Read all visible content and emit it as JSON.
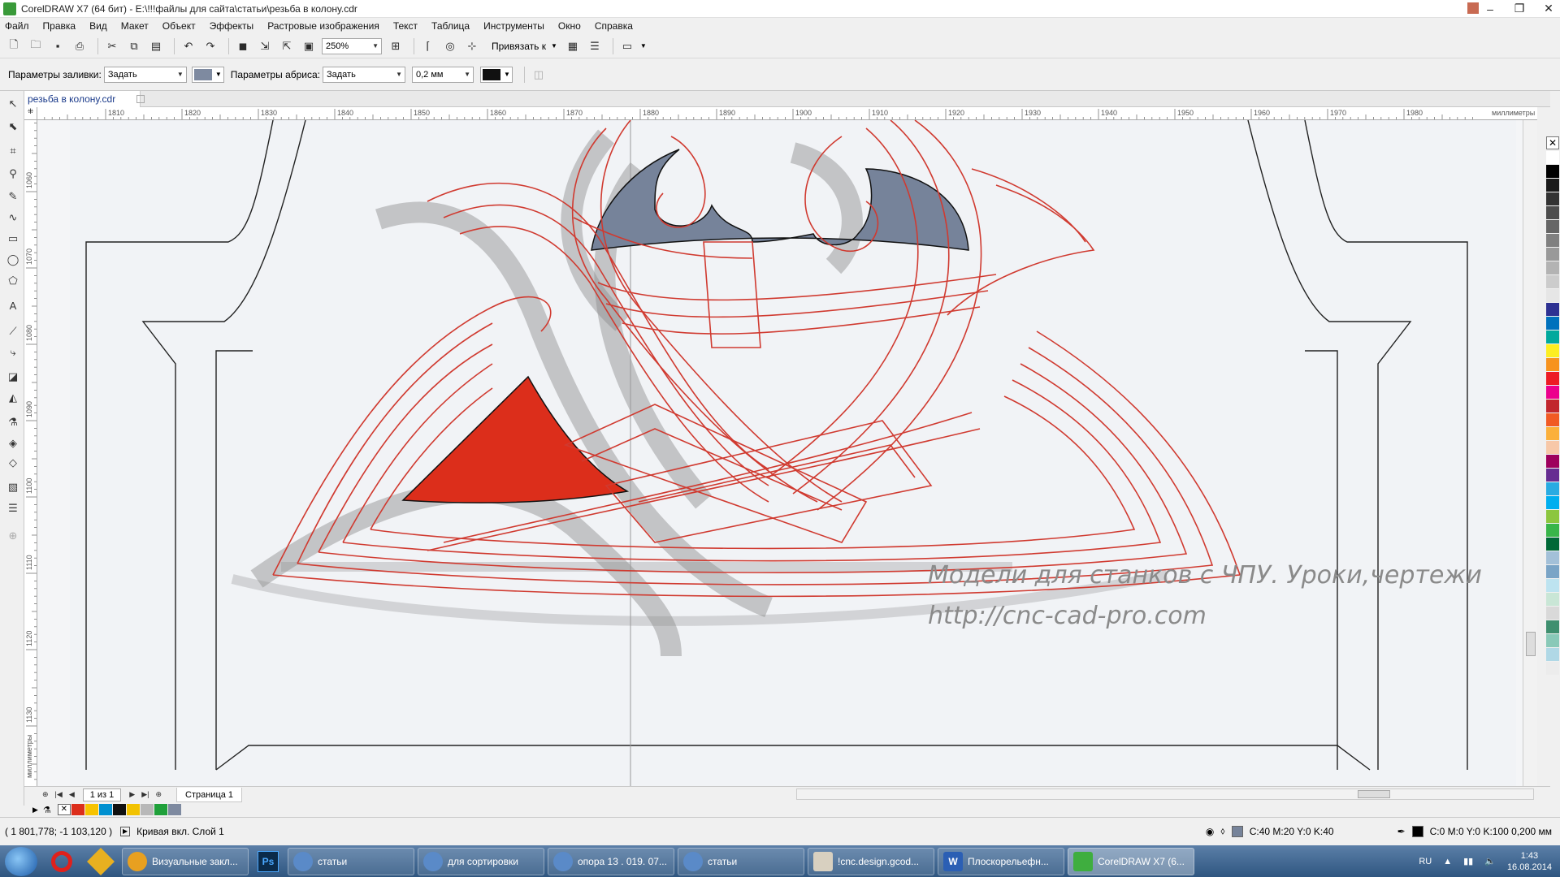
{
  "window": {
    "title": "CorelDRAW X7 (64 бит) - E:\\!!!файлы для сайта\\статьи\\резьба в колону.cdr",
    "controls": [
      "–",
      "❐",
      "✕"
    ]
  },
  "menu": [
    "Файл",
    "Правка",
    "Вид",
    "Макет",
    "Объект",
    "Эффекты",
    "Растровые изображения",
    "Текст",
    "Таблица",
    "Инструменты",
    "Окно",
    "Справка"
  ],
  "toolbar": {
    "zoom": "250%",
    "snap_label": "Привязать к"
  },
  "property_bar": {
    "fill_label": "Параметры заливки:",
    "fill_value": "Задать",
    "fill_color": "#7e8aa0",
    "outline_label": "Параметры абриса:",
    "outline_value": "Задать",
    "outline_width": "0,2 мм",
    "outline_color": "#111111"
  },
  "document": {
    "tab_name": "резьба в колону.cdr"
  },
  "rulers": {
    "horizontal_ticks": [
      "1810",
      "1820",
      "1830",
      "1840",
      "1850",
      "1860",
      "1870",
      "1880",
      "1890",
      "1900",
      "1910",
      "1920",
      "1930",
      "1940",
      "1950",
      "1960",
      "1970",
      "1980"
    ],
    "horizontal_unit": "миллиметры",
    "vertical_ticks": [
      "1060",
      "1070",
      "1080",
      "1090",
      "1100",
      "1110",
      "1120",
      "1130"
    ],
    "vertical_unit": "миллиметры"
  },
  "canvas": {
    "watermark_line1": "Модели для станков с ЧПУ. Уроки,чертежи",
    "watermark_line2": "http://cnc-cad-pro.com",
    "shape_fill_gray": "#76839a",
    "shape_fill_red": "#dc2e1b",
    "curve_color": "#d03a30"
  },
  "page_nav": {
    "page_count": "1 из 1",
    "page_tab": "Страница 1"
  },
  "palette": [
    "#ffffff",
    "#000000",
    "#1a1a1a",
    "#333333",
    "#4d4d4d",
    "#666666",
    "#808080",
    "#999999",
    "#b3b3b3",
    "#cccccc",
    "#e6e6e6",
    "#2e3192",
    "#0071bc",
    "#00a99d",
    "#fcee21",
    "#f7931e",
    "#ed1c24",
    "#ec008c",
    "#c1272d",
    "#f15a24",
    "#fbb03b",
    "#f7c8a8",
    "#9e005d",
    "#662d91",
    "#29abe2",
    "#00aeef",
    "#8cc63f",
    "#39b54a",
    "#006837",
    "#a3c0d8",
    "#7aa4c6",
    "#bde3f0",
    "#c9e6d6",
    "#d9d9d9",
    "#3f8f6f",
    "#89c9b8",
    "#b0d8e6",
    "#ececec"
  ],
  "doc_palette": [
    "#dc2e1b",
    "#f7c300",
    "#0090d0",
    "#111111",
    "#f2c200",
    "#b8b8b8",
    "#1fa03a",
    "#7e8aa0"
  ],
  "status": {
    "coords": "( 1 801,778; -1 103,120 )",
    "object_info": "Кривая вкл. Слой 1",
    "fill_info": "C:40 M:20 Y:0 K:40",
    "fill_color": "#76839a",
    "outline_info": "C:0 M:0 Y:0 K:100  0,200 мм",
    "outline_color": "#000000"
  },
  "taskbar": {
    "buttons": [
      {
        "label": "Визуальные закл...",
        "color": "#e8a020"
      },
      {
        "label": "статьи",
        "color": "#5a8ac8"
      },
      {
        "label": "для сортировки",
        "color": "#5a8ac8"
      },
      {
        "label": "опора 13 . 019. 07...",
        "color": "#5a8ac8"
      },
      {
        "label": "статьи",
        "color": "#5a8ac8"
      },
      {
        "label": "!cnc.design.gcod...",
        "color": "#d8d0c0"
      },
      {
        "label": "Плоскорельефн...",
        "color": "#2b5fb4"
      },
      {
        "label": "CorelDRAW X7 (6...",
        "color": "#3fae3f"
      }
    ],
    "lang": "RU",
    "time": "1:43",
    "date": "16.08.2014"
  }
}
